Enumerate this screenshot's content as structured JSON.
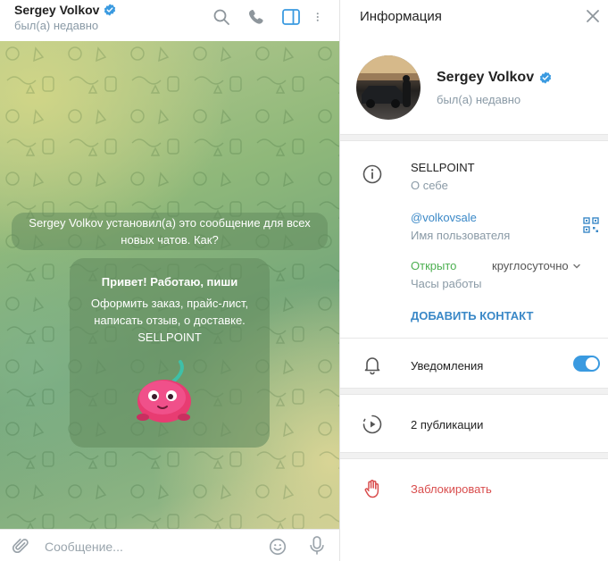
{
  "chat": {
    "name": "Sergey Volkov",
    "status": "был(а) недавно",
    "service_message": "Sergey Volkov установил(а) это сообщение для всех новых чатов. Как?",
    "bot_card": {
      "greeting": "Привет! Работаю, пиши",
      "description": "Оформить заказ, прайс-лист, написать отзыв, о доставке. SELLPOINT"
    },
    "composer": {
      "placeholder": "Сообщение..."
    },
    "icons": {
      "search": "search-icon",
      "call": "phone-icon",
      "panel": "sidebar-toggle-icon",
      "more": "more-vertical-icon",
      "attach": "paperclip-icon",
      "emoji": "emoji-icon",
      "mic": "microphone-icon"
    }
  },
  "info_panel": {
    "title": "Информация",
    "profile": {
      "name": "Sergey Volkov",
      "status": "был(а) недавно"
    },
    "bio": {
      "value": "SELLPOINT",
      "label": "О себе"
    },
    "username": {
      "value": "@volkovsale",
      "label": "Имя пользователя"
    },
    "hours": {
      "state": "Открыто",
      "schedule": "круглосуточно",
      "label": "Часы работы"
    },
    "add_contact": "ДОБАВИТЬ КОНТАКТ",
    "notifications": {
      "label": "Уведомления",
      "enabled": true
    },
    "publications": "2 публикации",
    "block": "Заблокировать"
  },
  "colors": {
    "accent": "#3a88c7",
    "toggle_on": "#3a9ae0",
    "danger": "#d94d4d",
    "open_green": "#4caf50",
    "verified": "#3a9ae0"
  }
}
